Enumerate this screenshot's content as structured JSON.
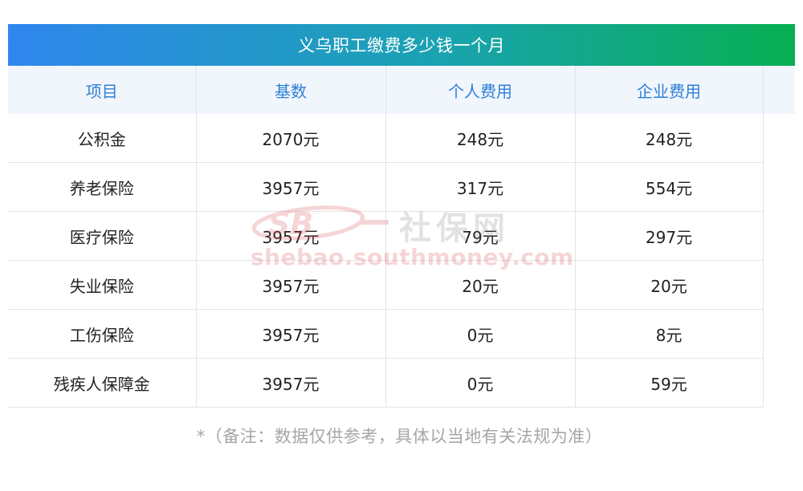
{
  "title": "义乌职工缴费多少钱一个月",
  "table": {
    "headers": [
      "项目",
      "基数",
      "个人费用",
      "企业费用"
    ],
    "rows": [
      [
        "公积金",
        "2070元",
        "248元",
        "248元"
      ],
      [
        "养老保险",
        "3957元",
        "317元",
        "554元"
      ],
      [
        "医疗保险",
        "3957元",
        "79元",
        "297元"
      ],
      [
        "失业保险",
        "3957元",
        "20元",
        "20元"
      ],
      [
        "工伤保险",
        "3957元",
        "0元",
        "8元"
      ],
      [
        "残疾人保障金",
        "3957元",
        "0元",
        "59元"
      ]
    ]
  },
  "watermark": {
    "logo_text": "SB",
    "brand_cn": "社保网",
    "url": "shebao.southmoney.com"
  },
  "note": "*（备注：数据仅供参考，具体以当地有关法规为准）",
  "colors": {
    "title_gradient_start": "#2f86ee",
    "title_gradient_end": "#07ae52",
    "header_bg": "#f1f6fd",
    "header_text": "#2f7fd6",
    "note_text": "#a6a6a6",
    "watermark_red": "#d9434a"
  }
}
